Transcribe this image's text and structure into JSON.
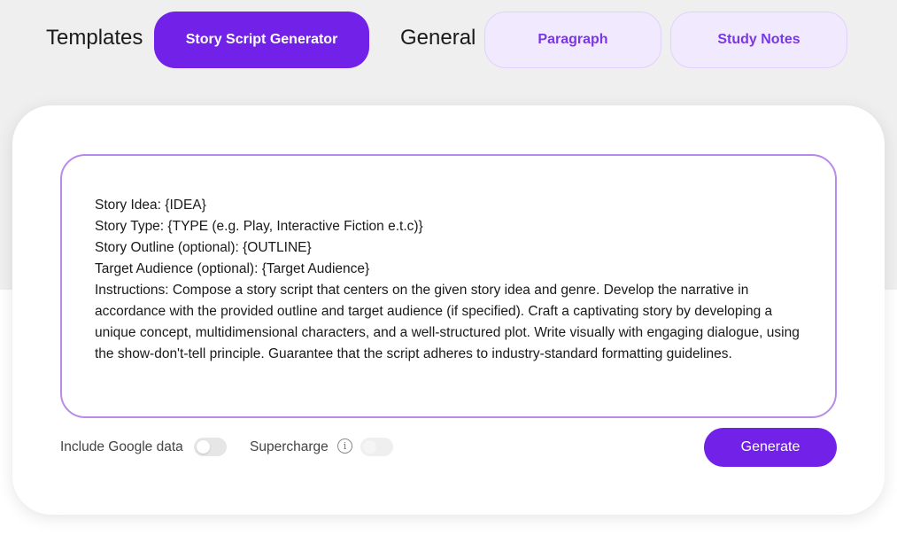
{
  "header": {
    "groups": [
      {
        "label": "Templates",
        "items": [
          {
            "label": "Story Script Generator",
            "active": true
          }
        ]
      },
      {
        "label": "General",
        "items": [
          {
            "label": "Paragraph",
            "active": false
          },
          {
            "label": "Study Notes",
            "active": false
          }
        ]
      }
    ]
  },
  "prompt": {
    "lines": [
      "Story Idea: {IDEA}",
      "Story Type: {TYPE (e.g. Play, Interactive Fiction e.t.c)}",
      "Story Outline (optional): {OUTLINE}",
      "Target Audience (optional): {Target Audience}",
      "Instructions: Compose a story script that centers on the given story idea and genre. Develop the narrative in accordance with the provided outline and target audience (if specified). Craft a captivating story by developing a unique concept, multidimensional characters, and a well-structured plot. Write visually with engaging dialogue, using the show-don't-tell principle. Guarantee that the script adheres to industry-standard formatting guidelines."
    ]
  },
  "options": {
    "google_data": {
      "label": "Include Google data",
      "enabled": false
    },
    "supercharge": {
      "label": "Supercharge",
      "info_icon": "info-icon",
      "enabled": false
    }
  },
  "actions": {
    "generate_label": "Generate"
  },
  "colors": {
    "accent": "#7121e8",
    "pill_inactive_bg": "#f1e9fe",
    "pill_inactive_text": "#7a37e6",
    "prompt_border": "#b98be8"
  }
}
